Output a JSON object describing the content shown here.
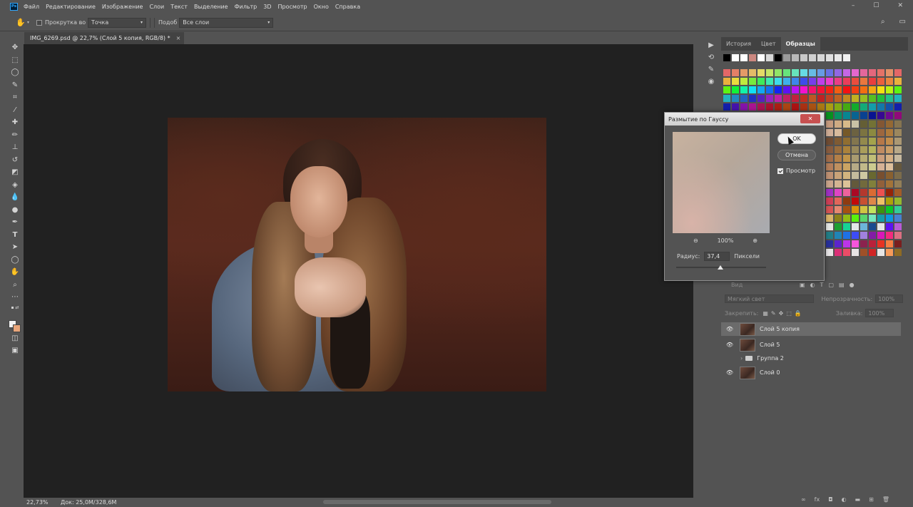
{
  "app": {
    "logo": "Ps"
  },
  "menu": [
    "Файл",
    "Редактирование",
    "Изображение",
    "Слои",
    "Текст",
    "Выделение",
    "Фильтр",
    "3D",
    "Просмотр",
    "Окно",
    "Справка"
  ],
  "window_controls": {
    "minimize": "–",
    "maximize": "☐",
    "close": "✕"
  },
  "options_bar": {
    "scroll_all_label": "Прокрутка во в",
    "sample_size_value": "Точка",
    "sample_label": "Подоб",
    "sample_value": "Все слои"
  },
  "document_tab": {
    "title": "IMG_6269.psd @ 22,7% (Слой 5 копия, RGB/8) *",
    "close": "×"
  },
  "status_bar": {
    "zoom": "22,73%",
    "doc_info": "Док: 25,0M/328,6M"
  },
  "panel_tabs": [
    {
      "label": "История",
      "active": false
    },
    {
      "label": "Цвет",
      "active": false
    },
    {
      "label": "Образцы",
      "active": true
    }
  ],
  "layers": {
    "kind_label": "Вид",
    "blend_mode": "Мягкий свет",
    "opacity_label": "Непрозрачность:",
    "opacity_value": "100%",
    "lock_label": "Закрепить:",
    "fill_label": "Заливка:",
    "fill_value": "100%",
    "items": [
      {
        "name": "Слой 5 копия",
        "visible": true,
        "selected": true,
        "type": "layer"
      },
      {
        "name": "Слой 5",
        "visible": true,
        "selected": false,
        "type": "layer"
      },
      {
        "name": "Группа 2",
        "visible": false,
        "selected": false,
        "type": "group"
      },
      {
        "name": "Слой 0",
        "visible": true,
        "selected": false,
        "type": "layer"
      }
    ]
  },
  "dialog": {
    "title": "Размытие по Гауссу",
    "ok_label": "OK",
    "cancel_label": "Отмена",
    "preview_label": "Просмотр",
    "preview_checked": true,
    "zoom_value": "100%",
    "radius_label": "Радиус:",
    "radius_value": "37,4",
    "radius_unit": "Пиксели",
    "close_label": "✕"
  },
  "colors": {
    "ui_bg": "#535353",
    "canvas_bg": "#212121",
    "accent_blue": "#31a8ff",
    "foreground_color": "#f2f2f2",
    "background_color": "#e8a57a"
  }
}
